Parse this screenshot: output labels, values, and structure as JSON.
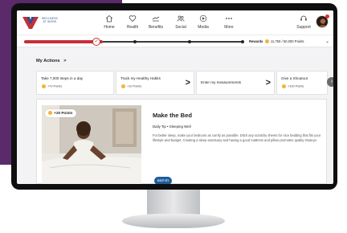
{
  "brand": {
    "logo_text": "WELLNESS AT WORK",
    "colors": {
      "purple_bg": "#5a2a6a",
      "accent_red": "#c62f38",
      "navy": "#2f4e86",
      "button_blue": "#1f5d9c",
      "coin": "#f2b33d"
    }
  },
  "nav": {
    "items": [
      {
        "label": "Home",
        "icon": "home-icon"
      },
      {
        "label": "Health",
        "icon": "heart-icon"
      },
      {
        "label": "Benefits",
        "icon": "benefits-icon"
      },
      {
        "label": "Social",
        "icon": "social-icon"
      },
      {
        "label": "Media",
        "icon": "media-icon"
      },
      {
        "label": "More",
        "icon": "more-icon"
      }
    ],
    "support_label": "Support"
  },
  "progress": {
    "fraction": 0.36,
    "rewards_label": "Rewards",
    "rewards_value": "11,750 / 50,000 Points"
  },
  "my_actions": {
    "title": "My Actions",
    "title_arrow": ">",
    "cards": [
      {
        "title": "Take 7,000 steps in a day",
        "points": "+70 Points"
      },
      {
        "title": "Track my Healthy Habits",
        "points": "+10 Points",
        "chevron": ">"
      },
      {
        "title": "Enter my measurements",
        "points": "",
        "chevron": ">"
      },
      {
        "title": "Give a Shoutout",
        "points": "+100 Points"
      }
    ]
  },
  "main_card": {
    "points_badge": "+20 Points",
    "title": "Make the Bed",
    "tip": "Daily Tip • Sleeping Well",
    "body": "For better sleep, make your bedroom as comfy as possible. Ditch any scratchy sheets for nice bedding that fits your lifestyle and budget. Creating a sleep sanctuary and having a good mattress and pillow promotes quality shuteye.",
    "button_label": "GOT IT!"
  }
}
